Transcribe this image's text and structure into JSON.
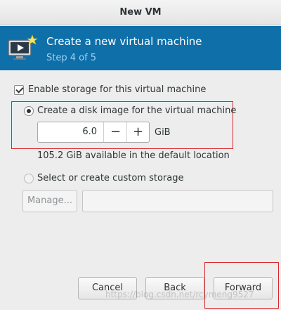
{
  "window": {
    "title": "New VM"
  },
  "banner": {
    "title": "Create a new virtual machine",
    "step": "Step 4 of 5",
    "icon": "monitor-play-icon"
  },
  "storage": {
    "enable_label": "Enable storage for this virtual machine",
    "enable_checked": true,
    "create_disk_label": "Create a disk image for the virtual machine",
    "create_disk_selected": true,
    "size_value": "6.0",
    "minus_label": "−",
    "plus_label": "+",
    "unit": "GiB",
    "available_text": "105.2 GiB available in the default location",
    "custom_label": "Select or create custom storage",
    "custom_selected": false,
    "manage_label": "Manage...",
    "custom_path": ""
  },
  "buttons": {
    "cancel": "Cancel",
    "back": "Back",
    "forward": "Forward"
  },
  "watermark": "https://blog.csdn.net/rcymeng9527",
  "colors": {
    "banner": "#0f6fa8",
    "highlight_box": "#d9262b"
  }
}
